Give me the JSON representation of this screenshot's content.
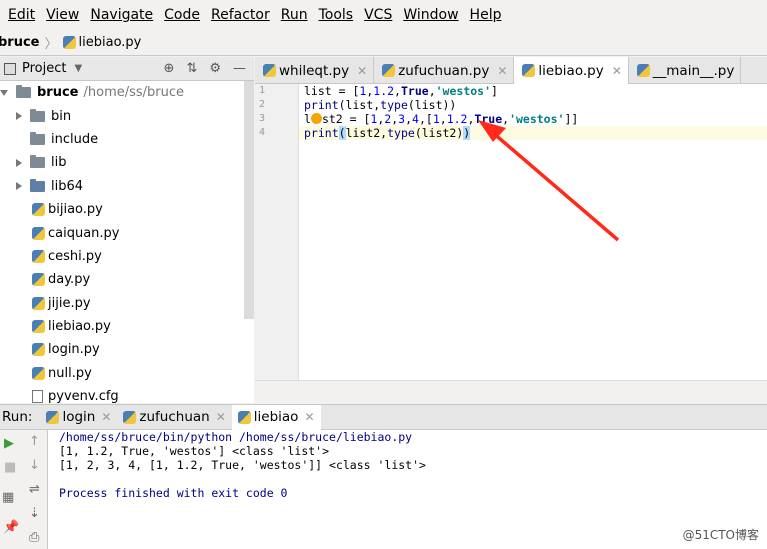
{
  "menu": [
    "Edit",
    "View",
    "Navigate",
    "Code",
    "Refactor",
    "Run",
    "Tools",
    "VCS",
    "Window",
    "Help"
  ],
  "breadcrumb": {
    "root": "bruce",
    "file": "liebiao.py"
  },
  "project": {
    "title": "Project",
    "root_name": "bruce",
    "root_path": "/home/ss/bruce",
    "items": [
      {
        "name": "bin",
        "kind": "folder"
      },
      {
        "name": "include",
        "kind": "folder-plain"
      },
      {
        "name": "lib",
        "kind": "folder"
      },
      {
        "name": "lib64",
        "kind": "folder"
      },
      {
        "name": "bijiao.py",
        "kind": "py"
      },
      {
        "name": "caiquan.py",
        "kind": "py"
      },
      {
        "name": "ceshi.py",
        "kind": "py"
      },
      {
        "name": "day.py",
        "kind": "py"
      },
      {
        "name": "jijie.py",
        "kind": "py"
      },
      {
        "name": "liebiao.py",
        "kind": "py"
      },
      {
        "name": "login.py",
        "kind": "py"
      },
      {
        "name": "null.py",
        "kind": "py"
      },
      {
        "name": "pyvenv.cfg",
        "kind": "cfg"
      }
    ]
  },
  "editor_tabs": [
    "whileqt.py",
    "zufuchuan.py",
    "liebiao.py",
    "__main__.py"
  ],
  "editor": {
    "line_numbers": [
      "1",
      "2",
      "3",
      "4"
    ]
  },
  "run": {
    "label": "Run:",
    "tabs": [
      "login",
      "zufuchuan",
      "liebiao"
    ],
    "output": {
      "cmd": "/home/ss/bruce/bin/python /home/ss/bruce/liebiao.py",
      "line1": "[1, 1.2, True, 'westos'] <class 'list'>",
      "line2": "[1, 2, 3, 4, [1, 1.2, True, 'westos']] <class 'list'>",
      "finished": "Process finished with exit code 0"
    }
  },
  "watermark": "@51CTO博客",
  "colors": {
    "arrow": "#ff2a1a",
    "keyword": "#000080",
    "string": "#008080",
    "number": "#0000ff"
  }
}
